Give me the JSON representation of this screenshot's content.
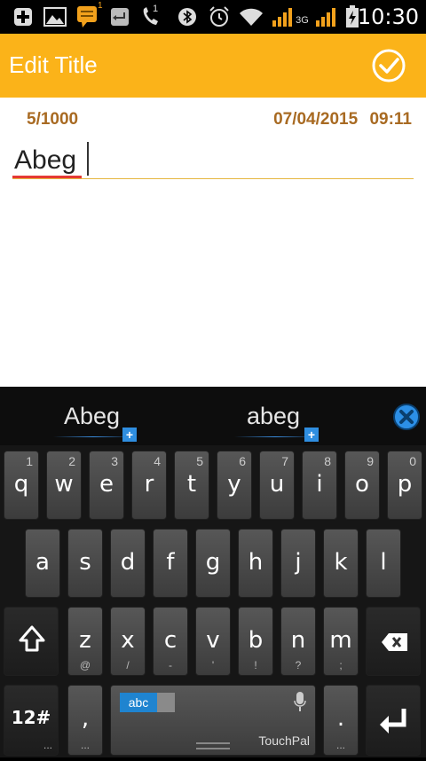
{
  "status_bar": {
    "time": "10:30",
    "notification_badge": "1",
    "signal1_label": "1",
    "signal2_label": "2",
    "network_type": "3G",
    "icons": [
      "add-icon",
      "image-icon",
      "message-icon",
      "return-icon",
      "phone-icon",
      "bluetooth-icon",
      "alarm-icon",
      "wifi-icon",
      "signal-icon",
      "battery-charging-icon"
    ]
  },
  "action_bar": {
    "title": "Edit Title",
    "confirm_icon": "check-circle-icon",
    "color": "#fbb319"
  },
  "editor": {
    "counter": "5/1000",
    "date": "07/04/2015",
    "time": "09:11",
    "title_value": "Abeg"
  },
  "keyboard": {
    "suggestions": [
      "Abeg",
      "abeg"
    ],
    "row1": [
      {
        "label": "q",
        "sub": "1"
      },
      {
        "label": "w",
        "sub": "2"
      },
      {
        "label": "e",
        "sub": "3"
      },
      {
        "label": "r",
        "sub": "4"
      },
      {
        "label": "t",
        "sub": "5"
      },
      {
        "label": "y",
        "sub": "6"
      },
      {
        "label": "u",
        "sub": "7"
      },
      {
        "label": "i",
        "sub": "8"
      },
      {
        "label": "o",
        "sub": "9"
      },
      {
        "label": "p",
        "sub": "0"
      }
    ],
    "row2": [
      "a",
      "s",
      "d",
      "f",
      "g",
      "h",
      "j",
      "k",
      "l"
    ],
    "row3": [
      {
        "label": "z",
        "sub": "@"
      },
      {
        "label": "x",
        "sub": "/"
      },
      {
        "label": "c",
        "sub": "-"
      },
      {
        "label": "v",
        "sub": "'"
      },
      {
        "label": "b",
        "sub": "!"
      },
      {
        "label": "n",
        "sub": "?"
      },
      {
        "label": "m",
        "sub": ";"
      }
    ],
    "symbols_key": "12#",
    "comma_key": ",",
    "period_key": ".",
    "space_lang": "abc",
    "brand": "TouchPal",
    "more_dots": "..."
  }
}
